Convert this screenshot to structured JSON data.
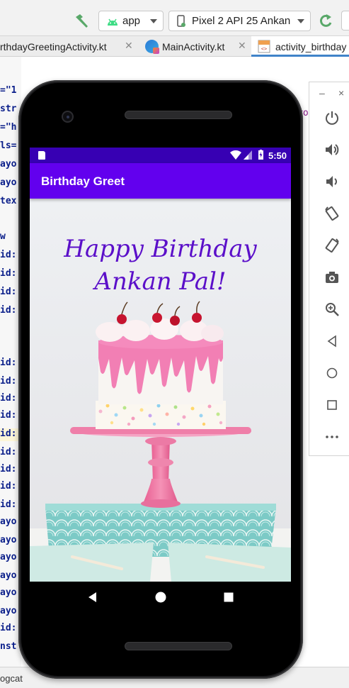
{
  "toolbar": {
    "run_config": "app",
    "device": "Pixel 2 API  25 Ankan"
  },
  "tabs": [
    {
      "label": "rthdayGreetingActivity.kt",
      "icon": "kotlin-file-icon"
    },
    {
      "label": "MainActivity.kt",
      "icon": "kotlin-file-icon"
    },
    {
      "label": "activity_birthday",
      "icon": "layout-xml-icon"
    }
  ],
  "editor": {
    "gutter_lines": [
      {
        "text": "=\"1",
        "y": 0
      },
      {
        "text": "str",
        "y": 0
      },
      {
        "text": "=\"h",
        "y": 0
      },
      {
        "text": "ls=",
        "y": 0
      },
      {
        "text": "ayo",
        "y": 0
      },
      {
        "text": "ayo",
        "y": 0
      },
      {
        "text": "tex",
        "y": 0
      },
      {
        "text": "w",
        "y": 0
      },
      {
        "text": "id:",
        "y": 0
      },
      {
        "text": "id:",
        "y": 0
      },
      {
        "text": "id:",
        "y": 0
      },
      {
        "text": "id:",
        "y": 0
      },
      {
        "text": "id:",
        "y": 0
      },
      {
        "text": "id:",
        "y": 0
      },
      {
        "text": "id:",
        "y": 0
      },
      {
        "text": "id:",
        "y": 0
      },
      {
        "text": "id:",
        "y": 0
      },
      {
        "text": "id:",
        "y": 0
      },
      {
        "text": "id:",
        "y": 0
      },
      {
        "text": "id:",
        "y": 0
      },
      {
        "text": "id:",
        "y": 0
      },
      {
        "text": "ayo",
        "y": 0
      },
      {
        "text": "ayo",
        "y": 0
      },
      {
        "text": "ayo",
        "y": 0
      },
      {
        "text": "ayo",
        "y": 0
      },
      {
        "text": "ayo",
        "y": 0
      },
      {
        "text": "ayo",
        "y": 0
      },
      {
        "text": "id:",
        "y": 0
      },
      {
        "text": "nst",
        "y": 0
      }
    ],
    "tail_text": "ro"
  },
  "emulator_panel": {
    "minimize_label": "–",
    "close_label": "×",
    "buttons": [
      "power-icon",
      "volume-up-icon",
      "volume-down-icon",
      "rotate-left-icon",
      "rotate-right-icon",
      "camera-icon",
      "zoom-icon",
      "back-icon",
      "home-icon",
      "overview-icon",
      "more-icon"
    ]
  },
  "bottom_bar": {
    "logcat": "ogcat"
  },
  "phone": {
    "status_time": "5:50",
    "app_title": "Birthday Greet",
    "greeting_line1": "Happy Birthday",
    "greeting_line2": "Ankan Pal!",
    "colors": {
      "status_bar": "#3700b3",
      "app_bar": "#6200ee",
      "greeting_text": "#5b0fc9"
    }
  }
}
